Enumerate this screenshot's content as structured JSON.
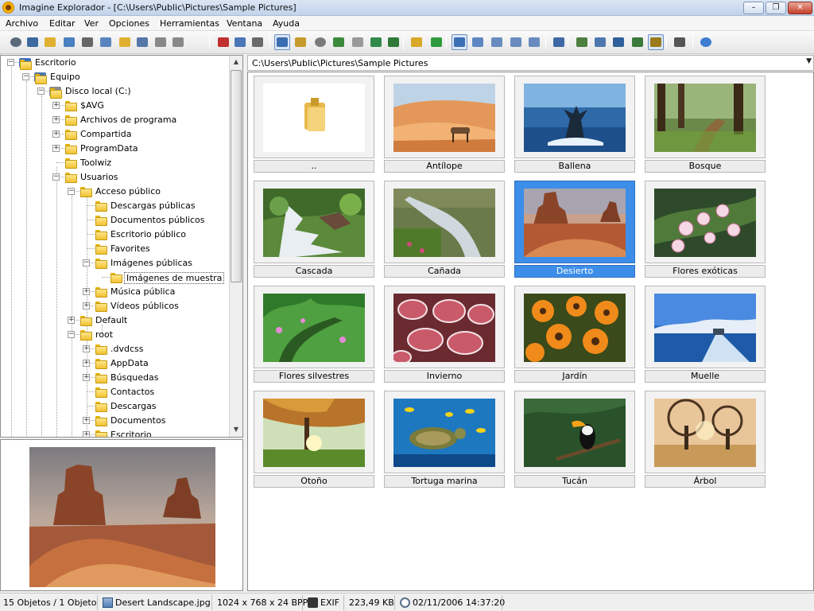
{
  "window": {
    "title": "Imagine Explorador - [C:\\Users\\Public\\Pictures\\Sample Pictures]",
    "minimize_glyph": "–",
    "restore_glyph": "❐",
    "close_glyph": "✕"
  },
  "menu": [
    "Archivo",
    "Editar",
    "Ver",
    "Opciones",
    "Herramientas",
    "Ventana",
    "Ayuda"
  ],
  "toolbar": {
    "icons": [
      "eye-icon",
      "slideshow-icon",
      "open-folder-icon",
      "save-icon",
      "print-icon",
      "copy-files-icon",
      "new-folder-icon",
      "rename-icon",
      "delete-icon",
      "properties-icon",
      "cut-icon",
      "copy-icon",
      "paste-icon",
      "view-full-icon",
      "view-filmstrip-icon",
      "view-round-icon",
      "view-thumb-icon",
      "view-grid-icon",
      "view-single-icon",
      "view-large-icon",
      "folder-up-icon",
      "refresh-icon",
      "thumbnails-icon",
      "list-icon",
      "details-icon",
      "small-icons-icon",
      "large-icons-icon",
      "settings-icon",
      "convert-icon",
      "batch-icon",
      "screen-capture-icon",
      "film-icon",
      "edit-icon",
      "paint-icon",
      "help-icon"
    ]
  },
  "tree": {
    "nodes": [
      {
        "label": "Escritorio",
        "icon": "desktop-icon"
      },
      {
        "label": "Equipo",
        "icon": "computer-icon"
      },
      {
        "label": "Disco local (C:)",
        "icon": "drive-icon"
      },
      {
        "label": "$AVG",
        "icon": "folder-icon"
      },
      {
        "label": "Archivos de programa",
        "icon": "folder-icon"
      },
      {
        "label": "Compartida",
        "icon": "folder-icon"
      },
      {
        "label": "ProgramData",
        "icon": "folder-icon"
      },
      {
        "label": "Toolwiz",
        "icon": "folder-icon"
      },
      {
        "label": "Usuarios",
        "icon": "folder-icon"
      },
      {
        "label": "Acceso público",
        "icon": "folder-icon"
      },
      {
        "label": "Descargas públicas",
        "icon": "folder-icon"
      },
      {
        "label": "Documentos públicos",
        "icon": "folder-icon"
      },
      {
        "label": "Escritorio público",
        "icon": "folder-icon"
      },
      {
        "label": "Favorites",
        "icon": "folder-icon"
      },
      {
        "label": "Imágenes públicas",
        "icon": "folder-icon"
      },
      {
        "label": "Imágenes de muestra",
        "icon": "folder-icon"
      },
      {
        "label": "Música pública",
        "icon": "folder-icon"
      },
      {
        "label": "Vídeos públicos",
        "icon": "folder-icon"
      },
      {
        "label": "Default",
        "icon": "folder-icon"
      },
      {
        "label": "root",
        "icon": "folder-icon"
      },
      {
        "label": ".dvdcss",
        "icon": "folder-icon"
      },
      {
        "label": "AppData",
        "icon": "folder-icon"
      },
      {
        "label": "Búsquedas",
        "icon": "folder-icon"
      },
      {
        "label": "Contactos",
        "icon": "folder-icon"
      },
      {
        "label": "Descargas",
        "icon": "folder-icon"
      },
      {
        "label": "Documentos",
        "icon": "folder-icon"
      },
      {
        "label": "Escritorio",
        "icon": "folder-icon"
      }
    ],
    "scroll_up": "▲",
    "scroll_down": "▼",
    "expander_plus": "+",
    "expander_minus": "−"
  },
  "path": {
    "value": "C:\\Users\\Public\\Pictures\\Sample Pictures",
    "drop_glyph": "▼"
  },
  "grid": {
    "items": [
      {
        "label": "..",
        "type": "parent-folder"
      },
      {
        "label": "Antílope",
        "type": "image"
      },
      {
        "label": "Ballena",
        "type": "image"
      },
      {
        "label": "Bosque",
        "type": "image"
      },
      {
        "label": "Cascada",
        "type": "image"
      },
      {
        "label": "Cañada",
        "type": "image"
      },
      {
        "label": "Desierto",
        "type": "image",
        "selected": true
      },
      {
        "label": "Flores exóticas",
        "type": "image"
      },
      {
        "label": "Flores silvestres",
        "type": "image"
      },
      {
        "label": "Invierno",
        "type": "image"
      },
      {
        "label": "Jardín",
        "type": "image"
      },
      {
        "label": "Muelle",
        "type": "image"
      },
      {
        "label": "Otoño",
        "type": "image"
      },
      {
        "label": "Tortuga marina",
        "type": "image"
      },
      {
        "label": "Tucán",
        "type": "image"
      },
      {
        "label": "Árbol",
        "type": "image"
      }
    ]
  },
  "status": {
    "objects": "15 Objetos / 1 Objeto",
    "filename": "Desert Landscape.jpg",
    "dimensions": "1024 x 768 x 24 BPP",
    "exif": "EXIF",
    "size": "223,49 KB",
    "date": "02/11/2006 14:37:20"
  },
  "colors": {
    "selection": "#3d8ee8",
    "title_gradient_top": "#dbe6f4",
    "close_button": "#c4402a"
  }
}
